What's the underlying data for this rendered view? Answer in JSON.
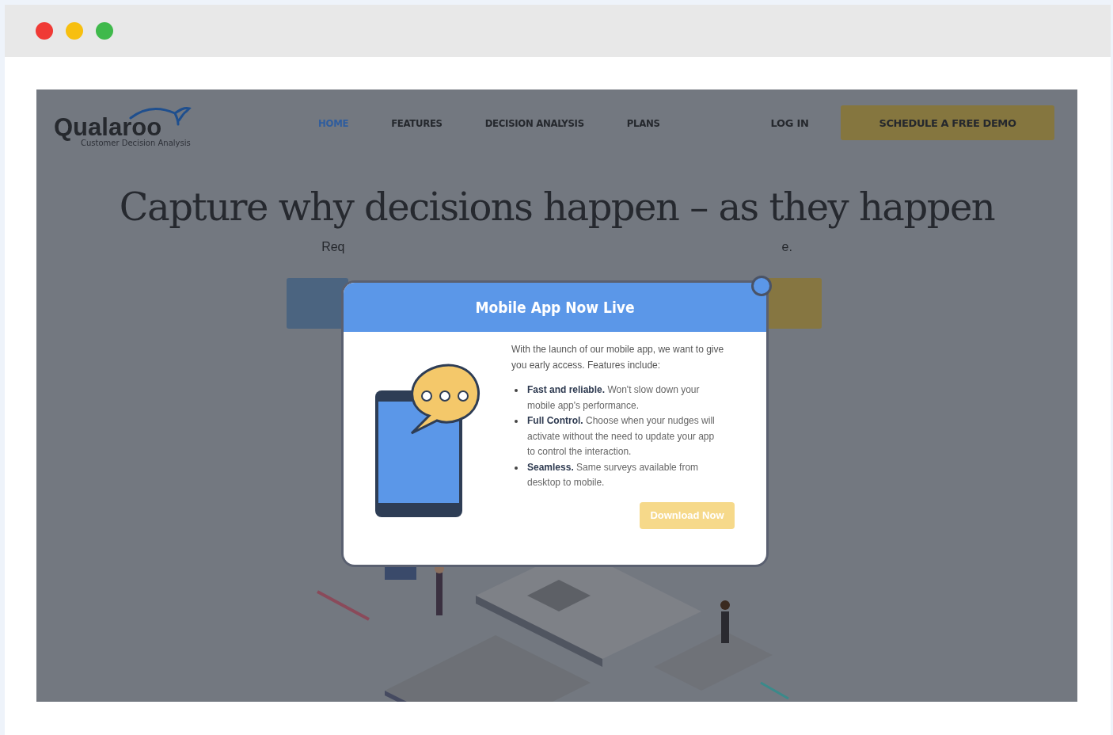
{
  "logo": {
    "name": "Qualaroo",
    "tagline": "Customer Decision Analysis"
  },
  "nav": {
    "items": [
      {
        "label": "HOME",
        "selected": true
      },
      {
        "label": "FEATURES",
        "selected": false
      },
      {
        "label": "DECISION ANALYSIS",
        "selected": false
      },
      {
        "label": "PLANS",
        "selected": false
      }
    ],
    "login": "LOG IN",
    "cta": "SCHEDULE A FREE DEMO"
  },
  "hero": {
    "heading": "Capture why decisions happen – as they happen",
    "subtitle_left": "Req",
    "subtitle_right": "e."
  },
  "modal": {
    "title": "Mobile App Now Live",
    "intro": "With the launch of our mobile app, we want to give you early access. Features include:",
    "features": [
      "**Fast and reliable.** Won't slow down your mobile app's performance.",
      "**Full Control.** Choose when your nudges will activate without the need to update your app to control the interaction.",
      "**Seamless.** Same surveys available from desktop to mobile."
    ],
    "button": "Download Now"
  }
}
